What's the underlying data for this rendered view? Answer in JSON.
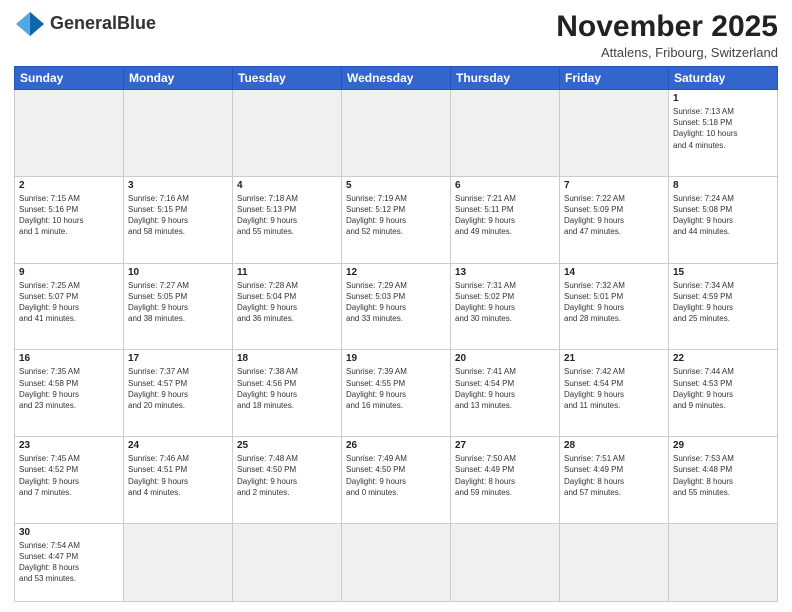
{
  "logo": {
    "text_normal": "General",
    "text_bold": "Blue"
  },
  "title": "November 2025",
  "subtitle": "Attalens, Fribourg, Switzerland",
  "days_of_week": [
    "Sunday",
    "Monday",
    "Tuesday",
    "Wednesday",
    "Thursday",
    "Friday",
    "Saturday"
  ],
  "weeks": [
    [
      {
        "day": "",
        "info": "",
        "empty": true
      },
      {
        "day": "",
        "info": "",
        "empty": true
      },
      {
        "day": "",
        "info": "",
        "empty": true
      },
      {
        "day": "",
        "info": "",
        "empty": true
      },
      {
        "day": "",
        "info": "",
        "empty": true
      },
      {
        "day": "",
        "info": "",
        "empty": true
      },
      {
        "day": "1",
        "info": "Sunrise: 7:13 AM\nSunset: 5:18 PM\nDaylight: 10 hours\nand 4 minutes."
      }
    ],
    [
      {
        "day": "2",
        "info": "Sunrise: 7:15 AM\nSunset: 5:16 PM\nDaylight: 10 hours\nand 1 minute."
      },
      {
        "day": "3",
        "info": "Sunrise: 7:16 AM\nSunset: 5:15 PM\nDaylight: 9 hours\nand 58 minutes."
      },
      {
        "day": "4",
        "info": "Sunrise: 7:18 AM\nSunset: 5:13 PM\nDaylight: 9 hours\nand 55 minutes."
      },
      {
        "day": "5",
        "info": "Sunrise: 7:19 AM\nSunset: 5:12 PM\nDaylight: 9 hours\nand 52 minutes."
      },
      {
        "day": "6",
        "info": "Sunrise: 7:21 AM\nSunset: 5:11 PM\nDaylight: 9 hours\nand 49 minutes."
      },
      {
        "day": "7",
        "info": "Sunrise: 7:22 AM\nSunset: 5:09 PM\nDaylight: 9 hours\nand 47 minutes."
      },
      {
        "day": "8",
        "info": "Sunrise: 7:24 AM\nSunset: 5:08 PM\nDaylight: 9 hours\nand 44 minutes."
      }
    ],
    [
      {
        "day": "9",
        "info": "Sunrise: 7:25 AM\nSunset: 5:07 PM\nDaylight: 9 hours\nand 41 minutes."
      },
      {
        "day": "10",
        "info": "Sunrise: 7:27 AM\nSunset: 5:05 PM\nDaylight: 9 hours\nand 38 minutes."
      },
      {
        "day": "11",
        "info": "Sunrise: 7:28 AM\nSunset: 5:04 PM\nDaylight: 9 hours\nand 36 minutes."
      },
      {
        "day": "12",
        "info": "Sunrise: 7:29 AM\nSunset: 5:03 PM\nDaylight: 9 hours\nand 33 minutes."
      },
      {
        "day": "13",
        "info": "Sunrise: 7:31 AM\nSunset: 5:02 PM\nDaylight: 9 hours\nand 30 minutes."
      },
      {
        "day": "14",
        "info": "Sunrise: 7:32 AM\nSunset: 5:01 PM\nDaylight: 9 hours\nand 28 minutes."
      },
      {
        "day": "15",
        "info": "Sunrise: 7:34 AM\nSunset: 4:59 PM\nDaylight: 9 hours\nand 25 minutes."
      }
    ],
    [
      {
        "day": "16",
        "info": "Sunrise: 7:35 AM\nSunset: 4:58 PM\nDaylight: 9 hours\nand 23 minutes."
      },
      {
        "day": "17",
        "info": "Sunrise: 7:37 AM\nSunset: 4:57 PM\nDaylight: 9 hours\nand 20 minutes."
      },
      {
        "day": "18",
        "info": "Sunrise: 7:38 AM\nSunset: 4:56 PM\nDaylight: 9 hours\nand 18 minutes."
      },
      {
        "day": "19",
        "info": "Sunrise: 7:39 AM\nSunset: 4:55 PM\nDaylight: 9 hours\nand 16 minutes."
      },
      {
        "day": "20",
        "info": "Sunrise: 7:41 AM\nSunset: 4:54 PM\nDaylight: 9 hours\nand 13 minutes."
      },
      {
        "day": "21",
        "info": "Sunrise: 7:42 AM\nSunset: 4:54 PM\nDaylight: 9 hours\nand 11 minutes."
      },
      {
        "day": "22",
        "info": "Sunrise: 7:44 AM\nSunset: 4:53 PM\nDaylight: 9 hours\nand 9 minutes."
      }
    ],
    [
      {
        "day": "23",
        "info": "Sunrise: 7:45 AM\nSunset: 4:52 PM\nDaylight: 9 hours\nand 7 minutes."
      },
      {
        "day": "24",
        "info": "Sunrise: 7:46 AM\nSunset: 4:51 PM\nDaylight: 9 hours\nand 4 minutes."
      },
      {
        "day": "25",
        "info": "Sunrise: 7:48 AM\nSunset: 4:50 PM\nDaylight: 9 hours\nand 2 minutes."
      },
      {
        "day": "26",
        "info": "Sunrise: 7:49 AM\nSunset: 4:50 PM\nDaylight: 9 hours\nand 0 minutes."
      },
      {
        "day": "27",
        "info": "Sunrise: 7:50 AM\nSunset: 4:49 PM\nDaylight: 8 hours\nand 59 minutes."
      },
      {
        "day": "28",
        "info": "Sunrise: 7:51 AM\nSunset: 4:49 PM\nDaylight: 8 hours\nand 57 minutes."
      },
      {
        "day": "29",
        "info": "Sunrise: 7:53 AM\nSunset: 4:48 PM\nDaylight: 8 hours\nand 55 minutes."
      }
    ],
    [
      {
        "day": "30",
        "info": "Sunrise: 7:54 AM\nSunset: 4:47 PM\nDaylight: 8 hours\nand 53 minutes.",
        "last": true
      },
      {
        "day": "",
        "info": "",
        "empty": true,
        "last": true
      },
      {
        "day": "",
        "info": "",
        "empty": true,
        "last": true
      },
      {
        "day": "",
        "info": "",
        "empty": true,
        "last": true
      },
      {
        "day": "",
        "info": "",
        "empty": true,
        "last": true
      },
      {
        "day": "",
        "info": "",
        "empty": true,
        "last": true
      },
      {
        "day": "",
        "info": "",
        "empty": true,
        "last": true
      }
    ]
  ]
}
